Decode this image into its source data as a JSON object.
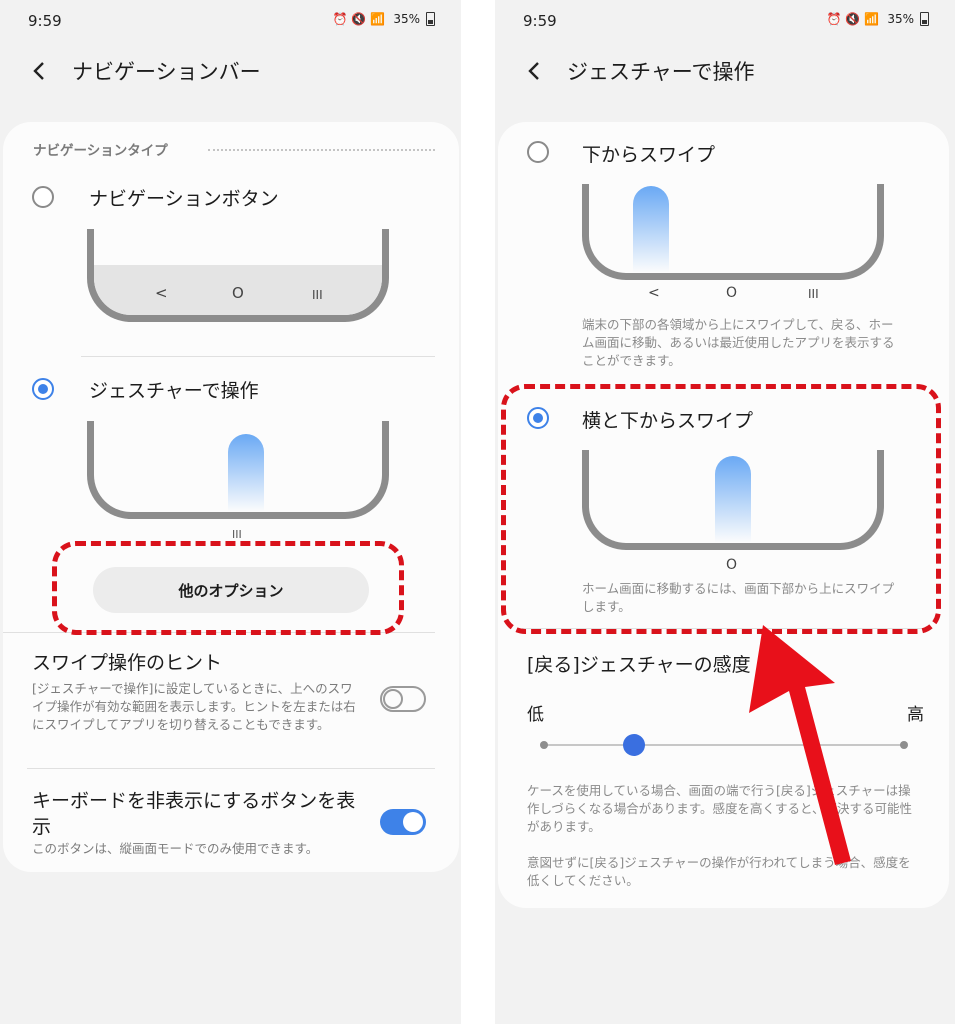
{
  "status": {
    "time": "9:59",
    "battery": "35%"
  },
  "left": {
    "title": "ナビゲーションバー",
    "section_label": "ナビゲーションタイプ",
    "option1": {
      "label": "ナビゲーションボタン",
      "nav_icons": [
        "<",
        "O",
        "III"
      ]
    },
    "option2": {
      "label": "ジェスチャーで操作",
      "handle": "III"
    },
    "more_options": "他のオプション",
    "swipe_hint": {
      "title": "スワイプ操作のヒント",
      "desc": "[ジェスチャーで操作]に設定しているときに、上へのスワイプ操作が有効な範囲を表示します。ヒントを左または右にスワイプしてアプリを切り替えることもできます。",
      "enabled": false
    },
    "keyboard": {
      "title": "キーボードを非表示にするボタンを表示",
      "desc": "このボタンは、縦画面モードでのみ使用できます。",
      "enabled": true
    }
  },
  "right": {
    "title": "ジェスチャーで操作",
    "option1": {
      "label": "下からスワイプ",
      "nav_icons": [
        "<",
        "O",
        "III"
      ],
      "desc": "端末の下部の各領域から上にスワイプして、戻る、ホーム画面に移動、あるいは最近使用したアプリを表示することができます。"
    },
    "option2": {
      "label": "横と下からスワイプ",
      "home_icon": "O",
      "desc": "ホーム画面に移動するには、画面下部から上にスワイプします。"
    },
    "sensitivity": {
      "title": "[戻る]ジェスチャーの感度",
      "low": "低",
      "high": "高",
      "value": 2,
      "steps": 5
    },
    "note1": "ケースを使用している場合、画面の端で行う[戻る]ジェスチャーは操作しづらくなる場合があります。感度を高くすると、解決する可能性があります。",
    "note2": "意図せずに[戻る]ジェスチャーの操作が行われてしまう場合、感度を低くしてください。"
  },
  "colors": {
    "accent": "#3e82e8",
    "annotation": "#d9121b",
    "arrow": "#e8101a"
  }
}
